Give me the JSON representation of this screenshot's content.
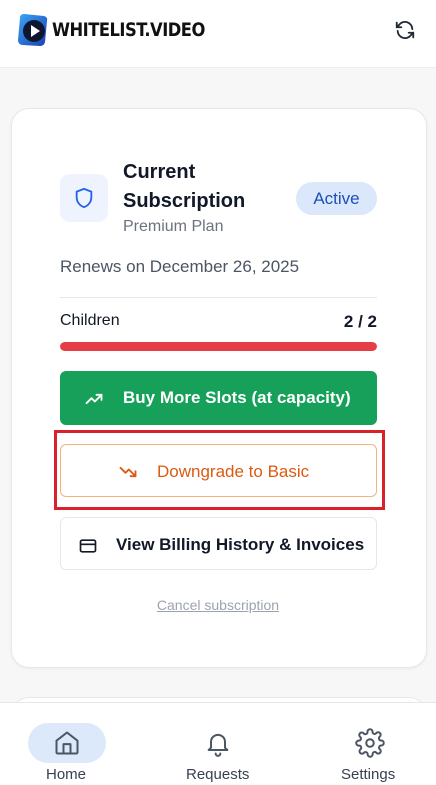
{
  "header": {
    "brand": "WHITELIST.VIDEO",
    "logo_icon": "play-logo-icon",
    "refresh_icon": "refresh-icon"
  },
  "subscription": {
    "title": "Current Subscription",
    "plan": "Premium Plan",
    "status": "Active",
    "renewal": "Renews on December 26, 2025",
    "children_label": "Children",
    "children_count": "2 / 2",
    "children_used_fraction": 1.0,
    "icon": "shield-icon"
  },
  "actions": {
    "buy_label": "Buy More Slots (at capacity)",
    "downgrade_label": "Downgrade to Basic",
    "billing_label": "View Billing History & Invoices",
    "cancel_label": "Cancel subscription"
  },
  "nav": {
    "items": [
      {
        "label": "Home",
        "icon": "home-icon",
        "active": true
      },
      {
        "label": "Requests",
        "icon": "bell-icon",
        "active": false
      },
      {
        "label": "Settings",
        "icon": "gear-icon",
        "active": false
      }
    ]
  },
  "colors": {
    "accent_green": "#16a05a",
    "progress_red": "#e53e45",
    "downgrade_orange": "#dc5a12",
    "badge_blue": "#1d4fb8",
    "highlight_red": "#d9202b"
  }
}
